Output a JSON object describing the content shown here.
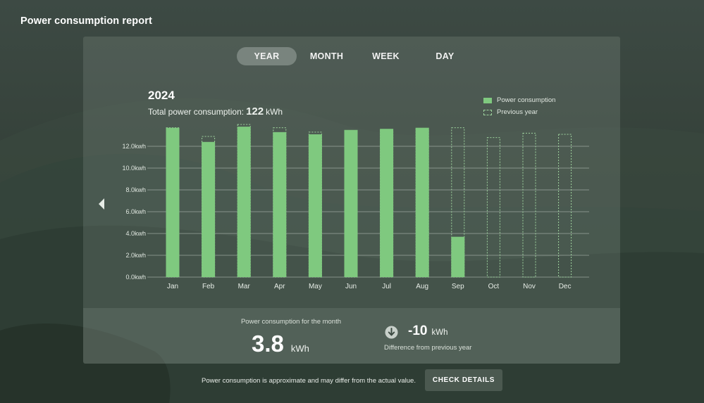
{
  "app": {
    "title": "Power consumption report"
  },
  "tabs": [
    {
      "label": "YEAR",
      "active": true
    },
    {
      "label": "MONTH",
      "active": false
    },
    {
      "label": "WEEK",
      "active": false
    },
    {
      "label": "DAY",
      "active": false
    }
  ],
  "summary": {
    "year": "2024",
    "total_label": "Total power consumption:",
    "total_value": "122",
    "total_unit": "kWh"
  },
  "legend": {
    "current": "Power consumption",
    "previous": "Previous year"
  },
  "icons": {
    "prev": "chevron-left-icon",
    "diff": "arrow-down-circle-icon"
  },
  "colors": {
    "current_bar": "#7fc97f",
    "previous_outline": "#9ed39e",
    "gridline": "#b8c4bc"
  },
  "chart_data": {
    "type": "bar",
    "title": "",
    "xlabel": "",
    "ylabel": "",
    "categories": [
      "Jan",
      "Feb",
      "Mar",
      "Apr",
      "May",
      "Jun",
      "Jul",
      "Aug",
      "Sep",
      "Oct",
      "Nov",
      "Dec"
    ],
    "yticks": [
      "0.0kwh",
      "2.0kwh",
      "4.0kwh",
      "6.0kwh",
      "8.0kwh",
      "10.0kwh",
      "12.0kwh"
    ],
    "ylim": [
      0,
      14
    ],
    "grid": true,
    "legend_position": "top-right",
    "series": [
      {
        "name": "Power consumption",
        "style": "solid",
        "values": [
          13.7,
          12.4,
          13.8,
          13.3,
          13.1,
          13.5,
          13.6,
          13.7,
          3.7,
          null,
          null,
          null
        ]
      },
      {
        "name": "Previous year",
        "style": "dashed",
        "values": [
          13.7,
          12.9,
          14.0,
          13.7,
          13.3,
          13.1,
          13.5,
          13.6,
          13.7,
          12.8,
          13.2,
          13.1
        ]
      }
    ]
  },
  "footer": {
    "month_label": "Power consumption for the month",
    "month_value": "3.8",
    "month_unit": "kWh",
    "diff_value": "-10",
    "diff_unit": "kWh",
    "diff_label": "Difference from previous year"
  },
  "disclaimer": "Power consumption is approximate and may differ from the actual value.",
  "check_details_label": "CHECK DETAILS"
}
